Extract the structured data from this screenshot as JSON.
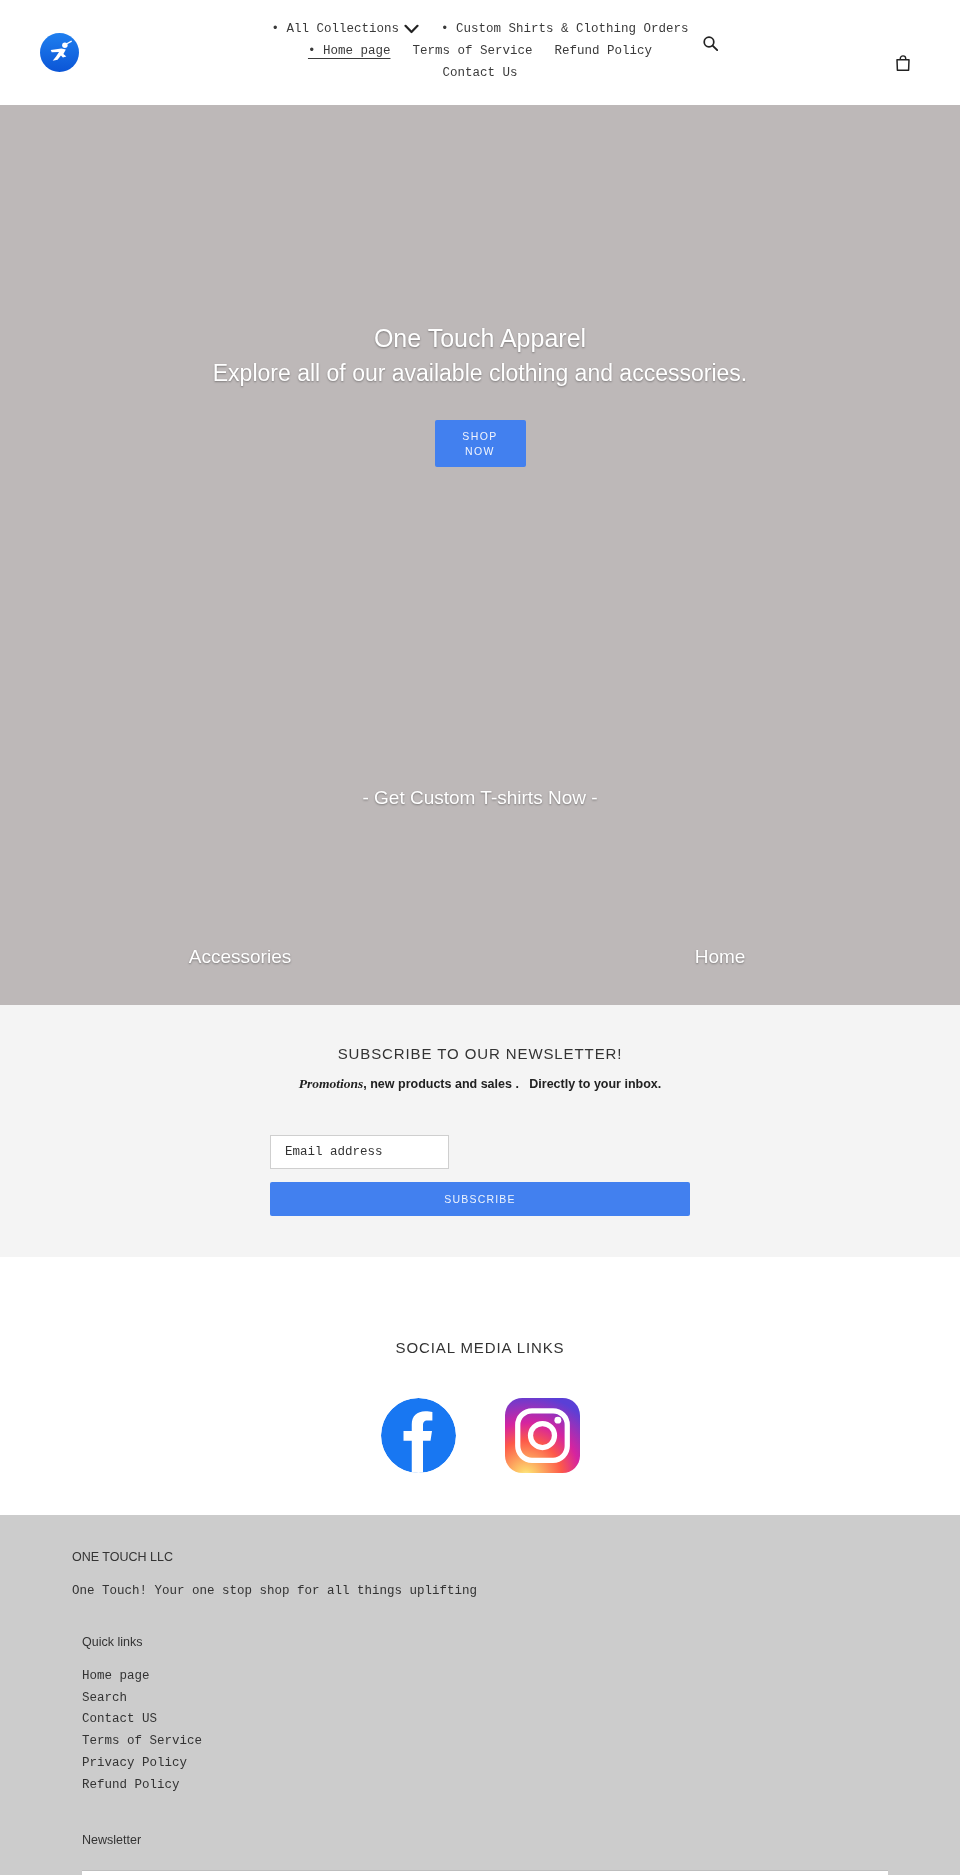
{
  "header": {
    "nav": [
      {
        "label": "• All Collections",
        "selected": false,
        "dropdown": true
      },
      {
        "label": "• Custom Shirts & Clothing Orders",
        "selected": false,
        "dropdown": false
      },
      {
        "label": "• Home page",
        "selected": true,
        "dropdown": false
      },
      {
        "label": "Terms of Service",
        "selected": false,
        "dropdown": false
      },
      {
        "label": "Refund Policy",
        "selected": false,
        "dropdown": false
      },
      {
        "label": "Contact Us",
        "selected": false,
        "dropdown": false
      }
    ]
  },
  "hero": {
    "title": "One Touch Apparel",
    "subtitle": "Explore all of our available clothing and accessories.",
    "button": "SHOP NOW",
    "tagline": "- Get Custom T-shirts Now -",
    "collections": [
      "Accessories",
      "Home"
    ]
  },
  "newsletter": {
    "heading": "SUBSCRIBE TO OUR NEWSLETTER!",
    "text": "*Promotions*, new products and sales .   Directly to your inbox.",
    "email": {
      "placeholder": "Email address"
    },
    "button": "SUBSCRIBE"
  },
  "social": {
    "heading": "SOCIAL MEDIA LINKS",
    "links": [
      {
        "kind": "facebook"
      },
      {
        "kind": "instagram"
      }
    ]
  },
  "footer": {
    "company": "ONE TOUCH LLC",
    "tagline": "One Touch! Your one stop shop for all things uplifting",
    "quick_links": {
      "heading": "Quick links",
      "items": [
        "Home page",
        "Search",
        "Contact US",
        "Terms of Service",
        "Privacy Policy",
        "Refund Policy"
      ]
    },
    "newsletter": {
      "heading": "Newsletter"
    }
  }
}
